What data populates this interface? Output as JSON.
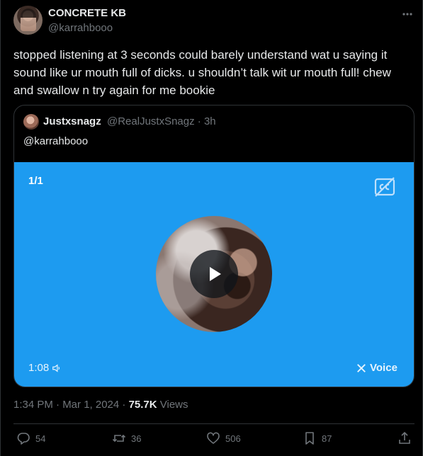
{
  "author": {
    "display_name": "CONCRETE KB",
    "handle": "@karrahbooo"
  },
  "tweet": {
    "text": "stopped listening at 3 seconds could barely understand wat u saying it sound like ur mouth full of dicks. u shouldn’t talk wit ur mouth full! chew and swallow n try again for me bookie"
  },
  "quote": {
    "display_name": "Justxsnagz",
    "handle_time": "@RealJustxSnagz · 3h",
    "text": "@karrahbooo",
    "media": {
      "counter": "1/1",
      "duration": "1:08",
      "voice_label": "Voice",
      "background_color": "#1d9bf0"
    }
  },
  "meta": {
    "timestamp": "1:34 PM · Mar 1, 2024 · ",
    "views_count": "75.7K",
    "views_label": " Views"
  },
  "actions": {
    "replies": "54",
    "reposts": "36",
    "likes": "506",
    "bookmarks": "87"
  },
  "icons": [
    "more-icon",
    "cc-icon",
    "play-icon",
    "speaker-icon",
    "x-logo-icon",
    "reply-icon",
    "repost-icon",
    "like-icon",
    "bookmark-icon",
    "share-icon"
  ],
  "colors": {
    "background": "#000000",
    "text": "#e7e9ea",
    "secondary": "#71767b",
    "accent": "#1d9bf0"
  }
}
